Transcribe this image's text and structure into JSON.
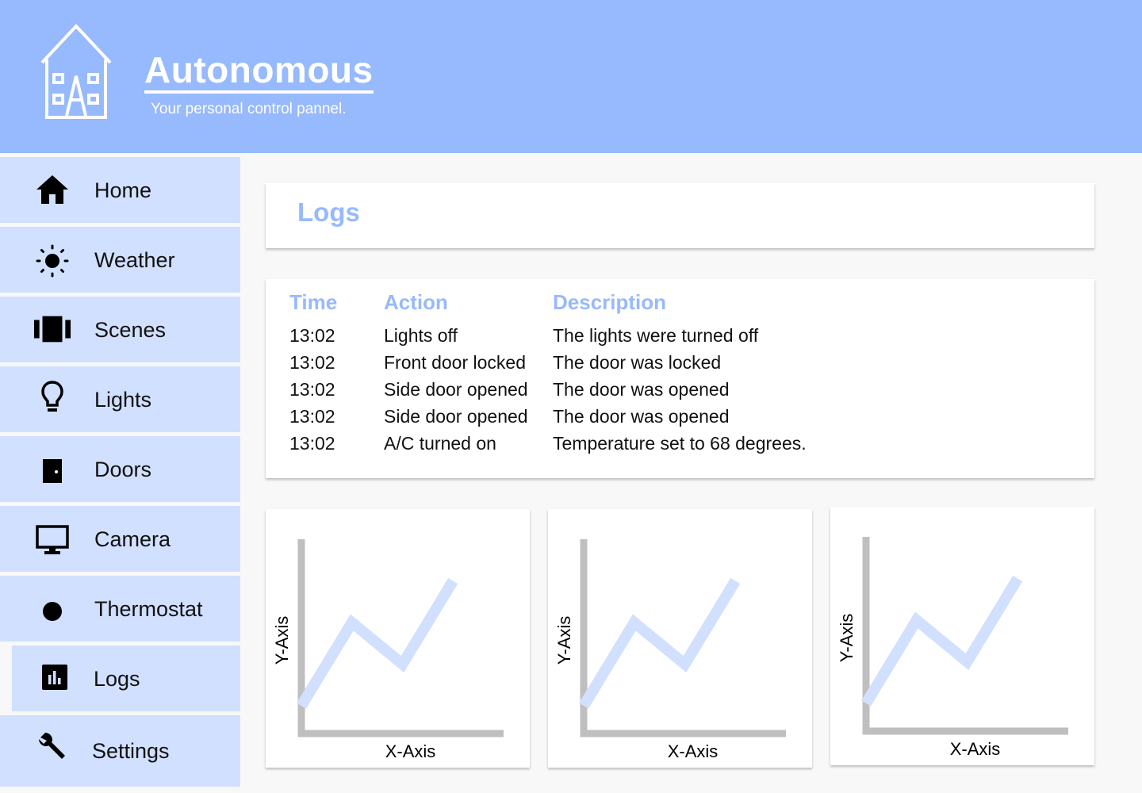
{
  "header": {
    "title": "Autonomous",
    "subtitle": "Your personal control pannel.",
    "logo_icon": "house-logo-icon",
    "color": "#97b9fd"
  },
  "sidebar": {
    "items": [
      {
        "label": "Home",
        "icon": "home-icon"
      },
      {
        "label": "Weather",
        "icon": "sun-icon"
      },
      {
        "label": "Scenes",
        "icon": "scenes-icon"
      },
      {
        "label": "Lights",
        "icon": "lightbulb-icon"
      },
      {
        "label": "Doors",
        "icon": "door-icon"
      },
      {
        "label": "Camera",
        "icon": "monitor-icon"
      },
      {
        "label": "Thermostat",
        "icon": "circle-icon"
      },
      {
        "label": "Logs",
        "icon": "bar-chart-icon",
        "active": true
      },
      {
        "label": "Settings",
        "icon": "wrench-icon"
      }
    ],
    "item_color": "#d1e0fe"
  },
  "logs_page": {
    "title": "Logs",
    "table": {
      "headers": {
        "time": "Time",
        "action": "Action",
        "description": "Description"
      },
      "rows": [
        {
          "time": "13:02",
          "action": "Lights off",
          "description": "The lights were turned off"
        },
        {
          "time": "13:02",
          "action": "Front door locked",
          "description": "The door was locked"
        },
        {
          "time": "13:02",
          "action": "Side door opened",
          "description": "The door was opened"
        },
        {
          "time": "13:02",
          "action": "Side door opened",
          "description": "The door was opened"
        },
        {
          "time": "13:02",
          "action": "A/C turned on",
          "description": "Temperature set to 68 degrees."
        }
      ]
    }
  },
  "chart_data": [
    {
      "type": "line",
      "xlabel": "X-Axis",
      "ylabel": "Y-Axis",
      "x": [
        0,
        1,
        2,
        3
      ],
      "y": [
        1,
        4,
        2.5,
        5.5
      ],
      "xlim": [
        0,
        4
      ],
      "ylim": [
        0,
        7
      ],
      "grid": false,
      "line_color": "#d1e0fe"
    },
    {
      "type": "line",
      "xlabel": "X-Axis",
      "ylabel": "Y-Axis",
      "x": [
        0,
        1,
        2,
        3
      ],
      "y": [
        1,
        4,
        2.5,
        5.5
      ],
      "xlim": [
        0,
        4
      ],
      "ylim": [
        0,
        7
      ],
      "grid": false,
      "line_color": "#d1e0fe"
    },
    {
      "type": "line",
      "xlabel": "X-Axis",
      "ylabel": "Y-Axis",
      "x": [
        0,
        1,
        2,
        3
      ],
      "y": [
        1,
        4,
        2.5,
        5.5
      ],
      "xlim": [
        0,
        4
      ],
      "ylim": [
        0,
        7
      ],
      "grid": false,
      "line_color": "#d1e0fe"
    }
  ]
}
